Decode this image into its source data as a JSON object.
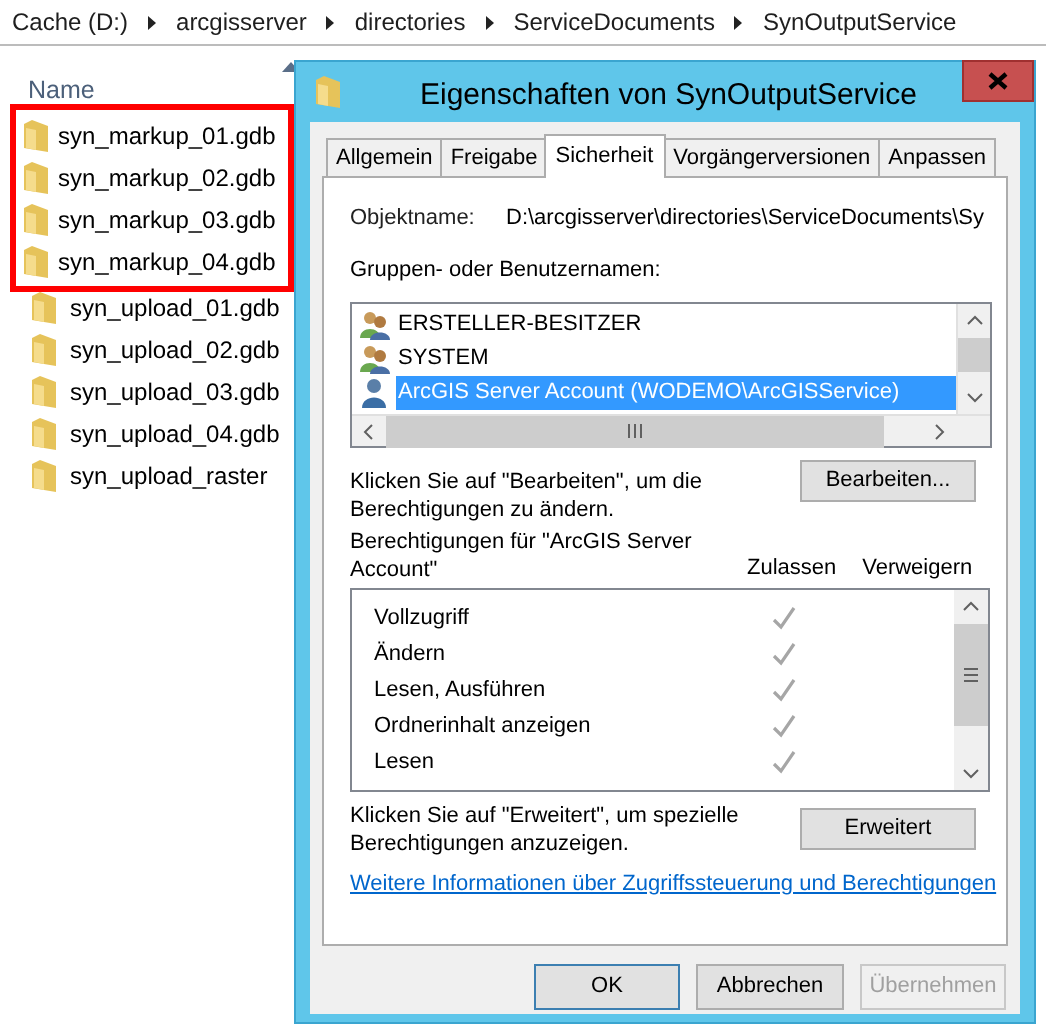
{
  "breadcrumb": [
    "Cache (D:)",
    "arcgisserver",
    "directories",
    "ServiceDocuments",
    "SynOutputService"
  ],
  "file_list": {
    "column": "Name",
    "files": [
      {
        "name": "syn_markup_01.gdb",
        "marked": true
      },
      {
        "name": "syn_markup_02.gdb",
        "marked": true
      },
      {
        "name": "syn_markup_03.gdb",
        "marked": true
      },
      {
        "name": "syn_markup_04.gdb",
        "marked": true
      },
      {
        "name": "syn_upload_01.gdb",
        "marked": false
      },
      {
        "name": "syn_upload_02.gdb",
        "marked": false
      },
      {
        "name": "syn_upload_03.gdb",
        "marked": false
      },
      {
        "name": "syn_upload_04.gdb",
        "marked": false
      },
      {
        "name": "syn_upload_raster",
        "marked": false
      }
    ]
  },
  "dialog": {
    "title": "Eigenschaften von SynOutputService",
    "tabs": [
      {
        "label": "Allgemein",
        "selected": false
      },
      {
        "label": "Freigabe",
        "selected": false
      },
      {
        "label": "Sicherheit",
        "selected": true
      },
      {
        "label": "Vorgängerversionen",
        "selected": false
      },
      {
        "label": "Anpassen",
        "selected": false
      }
    ],
    "object_label": "Objektname:",
    "object_name": "D:\\arcgisserver\\directories\\ServiceDocuments\\Sy",
    "groups_label": "Gruppen- oder Benutzernamen:",
    "users": [
      {
        "name": "ERSTELLER-BESITZER",
        "kind": "group",
        "selected": false
      },
      {
        "name": "SYSTEM",
        "kind": "group",
        "selected": false
      },
      {
        "name": "ArcGIS Server Account (WODEMO\\ArcGISService)",
        "kind": "user",
        "selected": true
      }
    ],
    "edit_hint": "Klicken Sie auf \"Bearbeiten\", um die Berechtigungen zu ändern.",
    "edit_button": "Bearbeiten...",
    "permissions_label": "Berechtigungen für \"ArcGIS Server Account\"",
    "columns": [
      "Zulassen",
      "Verweigern"
    ],
    "permissions": [
      {
        "name": "Vollzugriff",
        "allow": true
      },
      {
        "name": "Ändern",
        "allow": true
      },
      {
        "name": "Lesen, Ausführen",
        "allow": true
      },
      {
        "name": "Ordnerinhalt anzeigen",
        "allow": true
      },
      {
        "name": "Lesen",
        "allow": true
      }
    ],
    "advanced_hint": "Klicken Sie auf \"Erweitert\", um spezielle Berechtigungen anzuzeigen.",
    "advanced_button": "Erweitert",
    "link": "Weitere Informationen über Zugriffssteuerung und Berechtigungen",
    "buttons": [
      {
        "label": "OK",
        "kind": "default"
      },
      {
        "label": "Abbrechen",
        "kind": "normal"
      },
      {
        "label": "Übernehmen",
        "kind": "disabled"
      }
    ]
  }
}
